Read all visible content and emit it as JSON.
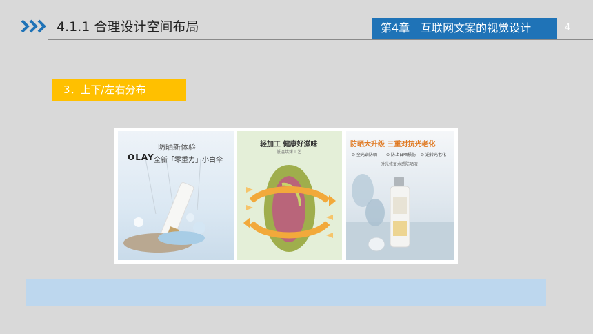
{
  "header": {
    "section_title": "4.1.1 合理设计空间布局",
    "chapter_title": "第4章　互联网文案的视觉设计",
    "page_number": "4",
    "accent_color": "#1f73b7"
  },
  "subheading": {
    "label": "3．上下/左右分布",
    "color": "#ffc000"
  },
  "gallery": {
    "panel_1": {
      "heading": "防晒新体验",
      "brand": "OLAY",
      "tagline": "全新「零重力」小白伞"
    },
    "panel_2": {
      "heading": "轻加工  健康好滋味",
      "subheading": "低温烘烤工艺"
    },
    "panel_3": {
      "heading": "防晒大升级  三重对抗光老化",
      "features": [
        "全光谱防晒",
        "防止日晒损伤",
        "逆转光老化"
      ],
      "subheading": "时光修复水感防晒液"
    }
  },
  "caption_bar_color": "#bdd7ee"
}
